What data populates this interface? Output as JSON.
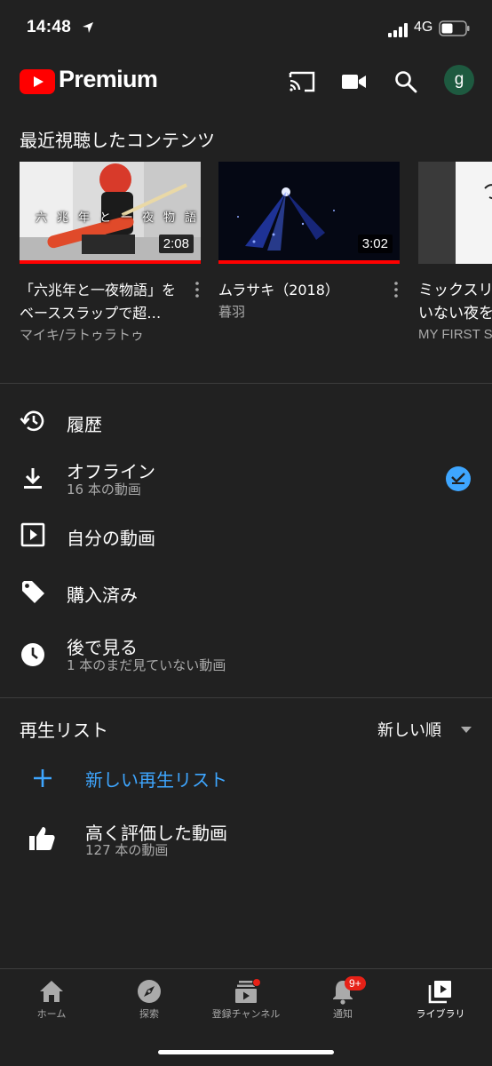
{
  "status_bar": {
    "time": "14:48",
    "network": "4G"
  },
  "header": {
    "logo_text": "Premium",
    "avatar_letter": "g",
    "icons": [
      "cast-icon",
      "video-camera-icon",
      "search-icon"
    ]
  },
  "recent": {
    "title": "最近視聴したコンテンツ",
    "videos": [
      {
        "title": "「六兆年と一夜物語」をベーススラップで超…",
        "channel": "マイキ/ラトゥラトゥ",
        "duration": "2:08",
        "thumb_caption": "六兆年と一夜物語",
        "watched": 1.0
      },
      {
        "title": "ムラサキ（2018）",
        "channel": "暮羽",
        "duration": "3:02",
        "watched": 1.0
      },
      {
        "title": "ミックスリ\nいない夜を",
        "channel": "MY FIRST S"
      }
    ]
  },
  "library": {
    "items": [
      {
        "label": "履歴",
        "icon": "history-icon"
      },
      {
        "label": "オフライン",
        "sub": "16 本の動画",
        "icon": "download-icon"
      },
      {
        "label": "自分の動画",
        "icon": "my-videos-icon"
      },
      {
        "label": "購入済み",
        "icon": "tag-icon"
      },
      {
        "label": "後で見る",
        "sub": "1 本のまだ見ていない動画",
        "icon": "clock-icon"
      }
    ]
  },
  "playlists": {
    "title": "再生リスト",
    "sort_label": "新しい順",
    "new_playlist": "新しい再生リスト",
    "liked": {
      "label": "高く評価した動画",
      "sub": "127 本の動画"
    }
  },
  "nav": {
    "items": [
      {
        "label": "ホーム",
        "icon": "home-icon"
      },
      {
        "label": "探索",
        "icon": "compass-icon"
      },
      {
        "label": "登録チャンネル",
        "icon": "subscriptions-icon"
      },
      {
        "label": "通知",
        "icon": "bell-icon",
        "badge": "9+"
      },
      {
        "label": "ライブラリ",
        "icon": "library-icon",
        "active": true
      }
    ]
  },
  "colors": {
    "background": "#212121",
    "accent_blue": "#3ea6ff",
    "brand_red": "#ff0000",
    "secondary_text": "#aaaaaa"
  }
}
